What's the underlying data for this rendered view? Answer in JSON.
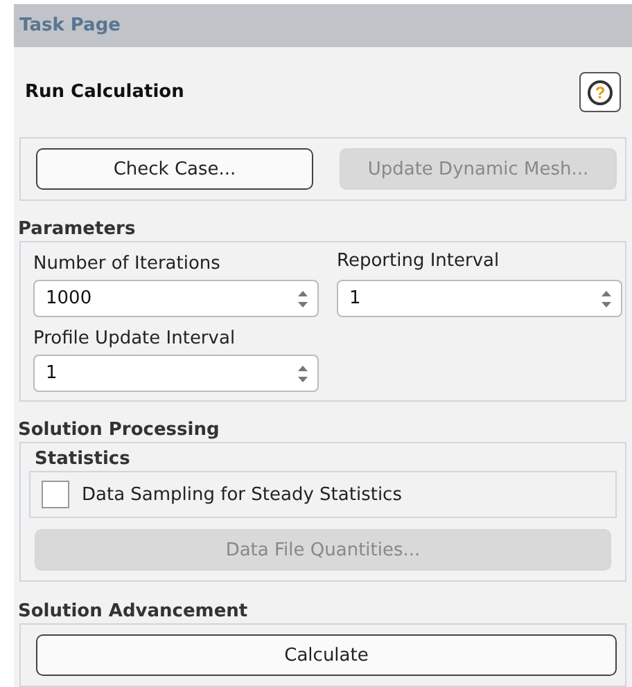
{
  "panel_title": "Task Page",
  "page_title": "Run Calculation",
  "help": {
    "symbol": "?"
  },
  "top_buttons": [
    {
      "label": "Check Case...",
      "disabled": false
    },
    {
      "label": "Update Dynamic Mesh...",
      "disabled": true
    }
  ],
  "parameters": {
    "heading": "Parameters",
    "fields": [
      {
        "label": "Number of Iterations",
        "value": "1000"
      },
      {
        "label": "Reporting Interval",
        "value": "1"
      },
      {
        "label": "Profile Update Interval",
        "value": "1"
      }
    ]
  },
  "solution_processing": {
    "heading": "Solution Processing",
    "statistics": {
      "heading": "Statistics",
      "checkbox": {
        "label": "Data Sampling for Steady Statistics",
        "checked": false
      }
    },
    "button": {
      "label": "Data File Quantities...",
      "disabled": true
    }
  },
  "solution_advancement": {
    "heading": "Solution Advancement",
    "button": {
      "label": "Calculate",
      "disabled": false
    }
  }
}
